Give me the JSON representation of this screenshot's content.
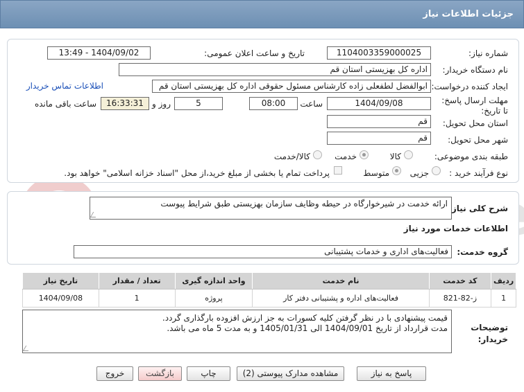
{
  "header": {
    "title": "جزئیات اطلاعات نیاز"
  },
  "form": {
    "need_number_label": "شماره نیاز:",
    "need_number": "1104003359000025",
    "announce_label": "تاریخ و ساعت اعلان عمومی:",
    "announce_value": "1404/09/02 - 13:49",
    "buyer_org_label": "نام دستگاه خریدار:",
    "buyer_org": "اداره کل بهزیستی استان قم",
    "creator_label": "ایجاد کننده درخواست:",
    "creator": "ابوالفضل لطفعلی زاده کارشناس مسئول حقوقی اداره کل بهزیستی استان قم",
    "contact_link": "اطلاعات تماس خریدار",
    "deadline_label": "مهلت ارسال پاسخ: تا تاریخ:",
    "deadline_date": "1404/09/08",
    "time_label": "ساعت",
    "deadline_time": "08:00",
    "days_value": "5",
    "days_label": "روز و",
    "remaining_time": "16:33:31",
    "remaining_label": "ساعت باقی مانده",
    "province_label": "استان محل تحویل:",
    "province": "قم",
    "city_label": "شهر محل تحویل:",
    "city": "قم",
    "category_label": "طبقه بندی موضوعی:",
    "category_options": [
      "کالا",
      "خدمت",
      "کالا/خدمت"
    ],
    "category_selected": "خدمت",
    "process_label": "نوع فرآیند خرید :",
    "process_options": [
      "جزیی",
      "متوسط"
    ],
    "process_selected": "متوسط",
    "payment_note": "پرداخت تمام یا بخشی از مبلغ خرید،از محل \"اسناد خزانه اسلامی\" خواهد بود."
  },
  "description": {
    "label": "شرح کلی نیاز:",
    "text": "ارائه خدمت در شیرخوارگاه  در حیطه وظایف سازمان بهزیستی طبق شرایط پیوست"
  },
  "services": {
    "section_title": "اطلاعات خدمات مورد نیاز",
    "group_label": "گروه خدمت:",
    "group_value": "فعالیت‌های اداری و خدمات پشتیبانی",
    "columns": [
      "ردیف",
      "کد خدمت",
      "نام خدمت",
      "واحد اندازه گیری",
      "تعداد / مقدار",
      "تاریخ نیاز"
    ],
    "rows": [
      [
        "1",
        "ز-82-821",
        "فعالیت‌های اداره و پشتیبانی دفتر کار",
        "پروژه",
        "1",
        "1404/09/08"
      ]
    ]
  },
  "buyer_notes": {
    "label": "توضیحات خریدار:",
    "lines": [
      "قیمت پیشنهادی با در نظر گرفتن کلیه کسورات به جز ارزش افزوده بارگذاری گردد.",
      "مدت قرارداد از تاریخ 1404/09/01 الی 1405/01/31 و به مدت 5 ماه می باشد."
    ]
  },
  "watermark": {
    "text": "AriaTender.net"
  },
  "buttons": {
    "reply": "پاسخ به نیاز",
    "attachments": "مشاهده مدارک پیوستی (2)",
    "print": "چاپ",
    "back": "بازگشت",
    "exit": "خروج"
  }
}
